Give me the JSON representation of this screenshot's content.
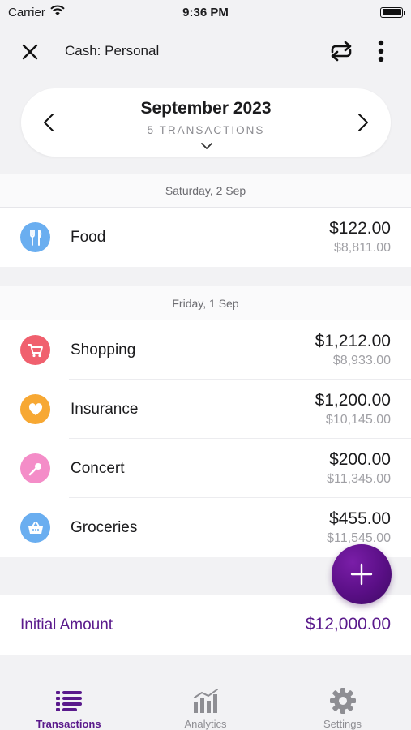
{
  "status_bar": {
    "carrier": "Carrier",
    "time": "9:36 PM"
  },
  "header": {
    "title": "Cash: Personal",
    "close_icon": "close-icon",
    "sync_icon": "sync-icon",
    "more_icon": "more-vertical-icon"
  },
  "month": {
    "title": "September 2023",
    "subtitle": "5 TRANSACTIONS"
  },
  "groups": [
    {
      "date": "Saturday, 2 Sep",
      "transactions": [
        {
          "category": "Food",
          "amount": "$122.00",
          "balance": "$8,811.00",
          "icon": "fork-knife-icon",
          "color": "#6aaef0"
        }
      ]
    },
    {
      "date": "Friday, 1 Sep",
      "transactions": [
        {
          "category": "Shopping",
          "amount": "$1,212.00",
          "balance": "$8,933.00",
          "icon": "cart-icon",
          "color": "#f0606e"
        },
        {
          "category": "Insurance",
          "amount": "$1,200.00",
          "balance": "$10,145.00",
          "icon": "heart-icon",
          "color": "#f7a833"
        },
        {
          "category": "Concert",
          "amount": "$200.00",
          "balance": "$11,345.00",
          "icon": "microphone-icon",
          "color": "#f48dc8"
        },
        {
          "category": "Groceries",
          "amount": "$455.00",
          "balance": "$11,545.00",
          "icon": "basket-icon",
          "color": "#6aaef0"
        }
      ]
    }
  ],
  "initial_amount": {
    "label": "Initial Amount",
    "value": "$12,000.00"
  },
  "fab": {
    "icon": "plus-icon"
  },
  "tabs": [
    {
      "label": "Transactions",
      "icon": "list-icon",
      "active": true
    },
    {
      "label": "Analytics",
      "icon": "bar-chart-icon",
      "active": false
    },
    {
      "label": "Settings",
      "icon": "gear-icon",
      "active": false
    }
  ],
  "colors": {
    "accent": "#5a1a8c",
    "fab": "#5a0f86",
    "muted_text": "#a0a0a5"
  }
}
